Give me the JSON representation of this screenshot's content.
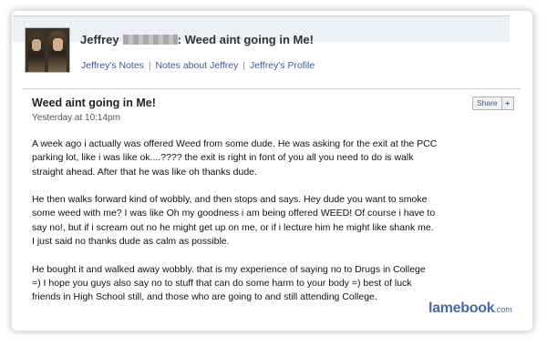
{
  "note": {
    "author_first": "Jeffrey",
    "title_suffix": ": Weed aint going in Me!",
    "headline": "Weed aint going in Me!",
    "timestamp": "Yesterday at 10:14pm",
    "share_label": "Share",
    "share_plus": "+"
  },
  "links": {
    "notes": "Jeffrey's Notes",
    "about": "Notes about Jeffrey",
    "profile": "Jeffrey's Profile",
    "separator": "|"
  },
  "paragraphs": [
    "A week ago i actually was offered Weed from some dude. He was asking for the exit at the PCC\nparking lot, like i was like ok....???? the exit is right in font of you all you need to do is walk\nstraight ahead. After that he was like oh thanks dude.",
    "He then walks forward kind of wobbly, and then stops and says. Hey dude you want to smoke\nsome weed with me? I was like Oh my goodness i am being offered WEED! Of course i have to\nsay no!, but if i scream out no he might get up on me, or if i lecture him he might like shank me.\nI just said no thanks dude as calm as possible.",
    "He bought it and walked away wobbly. that is my experience of saying no to Drugs in College\n=) I hope you guys also say no to stuff that can do some harm to your body =) best of luck\nfriends in High School still, and those who are going to and still attending College."
  ],
  "watermark": {
    "main": "lamebook",
    "tld": ".com"
  },
  "colors": {
    "link": "#3b5998",
    "header_band": "#eceff5",
    "logo": "#4a6aa5"
  }
}
